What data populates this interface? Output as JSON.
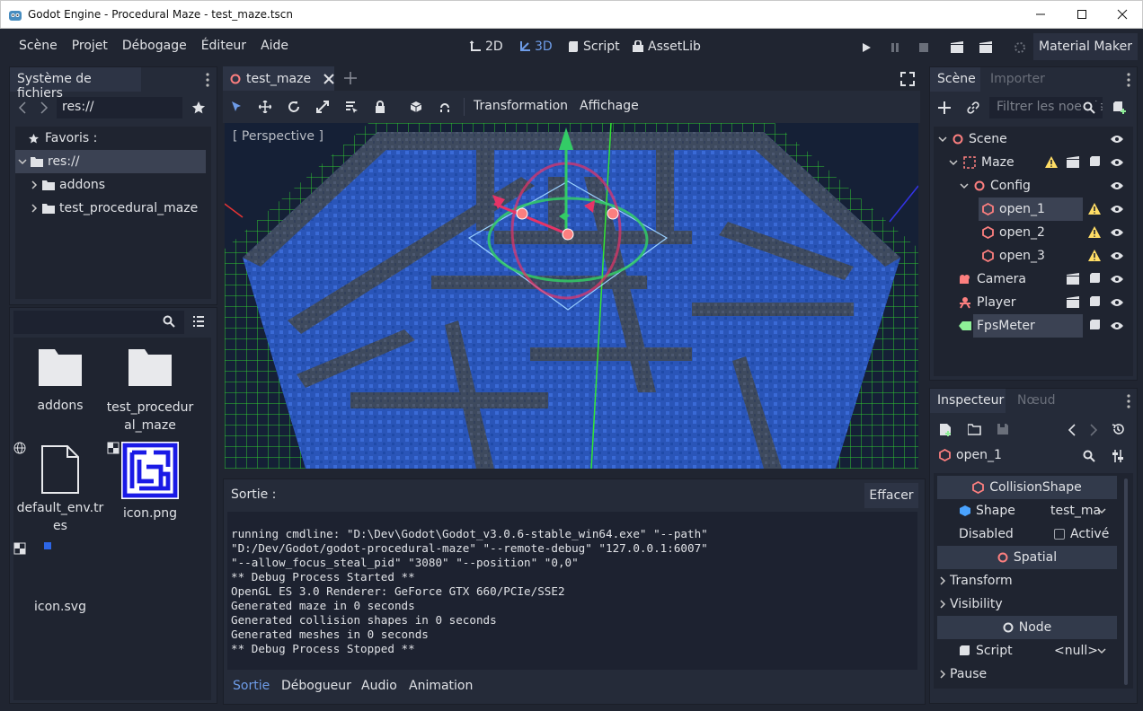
{
  "window": {
    "title": "Godot Engine - Procedural Maze - test_maze.tscn"
  },
  "menu": [
    "Scène",
    "Projet",
    "Débogage",
    "Éditeur",
    "Aide"
  ],
  "editors": {
    "e2d": "2D",
    "e3d": "3D",
    "script": "Script",
    "assetlib": "AssetLib"
  },
  "material_maker": "Material Maker",
  "filesystem": {
    "title": "Système de fichiers",
    "path": "res://",
    "favorites": "Favoris :",
    "tree": [
      "res://",
      "addons",
      "test_procedural_maze"
    ],
    "files": [
      {
        "l1": "addons",
        "l2": ""
      },
      {
        "l1": "test_procedur",
        "l2": "al_maze"
      },
      {
        "l1": "default_env.tr",
        "l2": "es"
      },
      {
        "l1": "icon.png",
        "l2": ""
      },
      {
        "l1": "icon.svg",
        "l2": ""
      }
    ]
  },
  "viewport": {
    "tab": "test_maze",
    "perspective": "[ Perspective ]",
    "menu_transform": "Transformation",
    "menu_view": "Affichage"
  },
  "output": {
    "title": "Sortie :",
    "clear": "Effacer",
    "lines": [
      "running cmdline: \"D:\\Dev\\Godot\\Godot_v3.0.6-stable_win64.exe\" \"--path\"",
      "\"D:/Dev/Godot/godot-procedural-maze\" \"--remote-debug\" \"127.0.0.1:6007\"",
      "\"--allow_focus_steal_pid\" \"3080\" \"--position\" \"0,0\"",
      "** Debug Process Started **",
      "OpenGL ES 3.0 Renderer: GeForce GTX 660/PCIe/SSE2",
      "Generated maze in 0 seconds",
      "Generated collision shapes in 0 seconds",
      "Generated meshes in 0 seconds",
      "** Debug Process Stopped **"
    ],
    "tabs": [
      "Sortie",
      "Débogueur",
      "Audio",
      "Animation"
    ]
  },
  "scene": {
    "tab_scene": "Scène",
    "tab_import": "Importer",
    "filter": "Filtrer les noeuds",
    "nodes": [
      {
        "name": "Scene",
        "indent": 0,
        "color": "#fc7f7f",
        "icon": "spatial-icon"
      },
      {
        "name": "Maze",
        "indent": 1,
        "color": "#fc7f7f",
        "icon": "gridmap-icon"
      },
      {
        "name": "Config",
        "indent": 2,
        "color": "#fc7f7f",
        "icon": "spatial-icon"
      },
      {
        "name": "open_1",
        "indent": 3,
        "color": "#fc7f7f",
        "icon": "collisionshape-icon"
      },
      {
        "name": "open_2",
        "indent": 3,
        "color": "#fc7f7f",
        "icon": "collisionshape-icon"
      },
      {
        "name": "open_3",
        "indent": 3,
        "color": "#fc7f7f",
        "icon": "collisionshape-icon"
      },
      {
        "name": "Camera",
        "indent": 1,
        "color": "#fc7f7f",
        "icon": "camera-icon"
      },
      {
        "name": "Player",
        "indent": 1,
        "color": "#fc7f7f",
        "icon": "kinematicbody-icon"
      },
      {
        "name": "FpsMeter",
        "indent": 1,
        "color": "#8eef97",
        "icon": "label-icon"
      }
    ]
  },
  "inspector": {
    "tab_inspector": "Inspecteur",
    "tab_node": "Nœud",
    "object": "open_1",
    "sec_collision": "CollisionShape",
    "shape_label": "Shape",
    "shape_value": "test_ma",
    "disabled_label": "Disabled",
    "disabled_value": "Activé",
    "sec_spatial": "Spatial",
    "transform": "Transform",
    "visibility": "Visibility",
    "sec_node": "Node",
    "script_label": "Script",
    "script_value": "<null>",
    "pause": "Pause"
  },
  "colors": {
    "accent": "#6e9ce8",
    "bg": "#202531",
    "panel": "#252b39",
    "warn": "#ffdd65",
    "node_red": "#fc7f7f"
  }
}
